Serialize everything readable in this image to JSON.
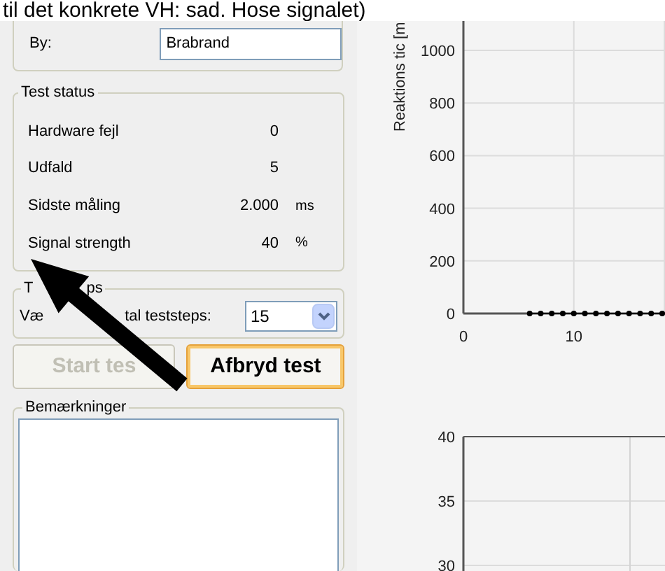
{
  "caption": "til det konkrete VH: sad. Hose signalet)",
  "info_group": {
    "fields": [
      {
        "label": "By:",
        "value": "Brabrand"
      }
    ]
  },
  "test_status": {
    "title": "Test status",
    "rows": [
      {
        "label": "Hardware fejl",
        "value": "0"
      },
      {
        "label": "Udfald",
        "value": "5"
      },
      {
        "label": "Sidste måling",
        "value": "2.000",
        "unit": "ms"
      },
      {
        "label": "Signal strength",
        "value": "40",
        "unit": "%"
      }
    ]
  },
  "teststeps": {
    "title_parts": [
      "T",
      "ps"
    ],
    "label_parts": [
      "Væ",
      "tal teststeps:"
    ],
    "value": "15"
  },
  "buttons": [
    {
      "label": "Start tes",
      "disabled": true,
      "default": false
    },
    {
      "label": "Afbryd test",
      "disabled": false,
      "default": true
    }
  ],
  "remarks": {
    "title": "Bemærkninger"
  },
  "charts": [
    {
      "chart_data": {
        "type": "line",
        "ylabel": "Reaktions tic [m",
        "xlim": [
          0,
          18
        ],
        "ylim": [
          0,
          1000
        ],
        "xticks": [
          0,
          10
        ],
        "yticks": [
          0,
          200,
          400,
          600,
          800,
          1000
        ],
        "x": [
          6,
          7,
          8,
          9,
          10,
          11,
          12,
          13,
          14,
          15,
          16,
          17,
          18
        ],
        "grid": true,
        "series": [
          {
            "color": "#000000",
            "marker": "circle",
            "values": [
              0,
              0,
              0,
              0,
              0,
              0,
              0,
              0,
              0,
              0,
              0,
              0,
              0
            ]
          }
        ]
      }
    },
    {
      "panel": {
        "y_tick_labels": [
          "40",
          "35",
          "30"
        ]
      }
    }
  ]
}
